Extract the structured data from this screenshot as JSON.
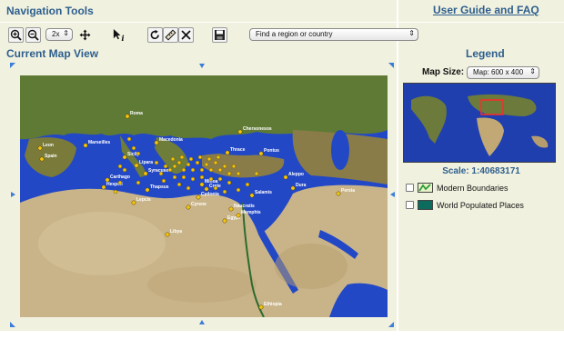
{
  "header": {
    "nav_title": "Navigation Tools",
    "guide_link": "User Guide and FAQ",
    "current_map_title": "Current Map View",
    "legend_title": "Legend"
  },
  "toolbar": {
    "zoom_level": "2x",
    "region_placeholder": "Find a region or country"
  },
  "legend": {
    "map_size_label": "Map Size:",
    "map_size_value": "Map: 600 x 400",
    "scale": "Scale: 1:40683171",
    "layers": [
      {
        "label": "Modern Boundaries",
        "swatch_color": "#2e9b3a"
      },
      {
        "label": "World Populated Places",
        "swatch_color": "#0b6b5d"
      }
    ]
  },
  "map": {
    "colors": {
      "sea": "#2348c6",
      "land": "#6b7a3c",
      "desert": "#c9b489",
      "place_dot": "#f1c40f"
    },
    "place_labels": [
      "Roma",
      "Marseilles",
      "Leon",
      "Spain",
      "Sicily",
      "Lipara",
      "Syracuse",
      "Carthago",
      "Hespeli",
      "Macedonia",
      "Thrace",
      "Pontus",
      "Chersonesos",
      "Cyrene",
      "Crete",
      "Minoa",
      "Cydonia",
      "Thapsus",
      "Libya",
      "Egypt",
      "Memphis",
      "Salamis",
      "Aleppo",
      "Dura",
      "Persia",
      "Ethiopia",
      "Lepcis",
      "Naucratis"
    ]
  }
}
